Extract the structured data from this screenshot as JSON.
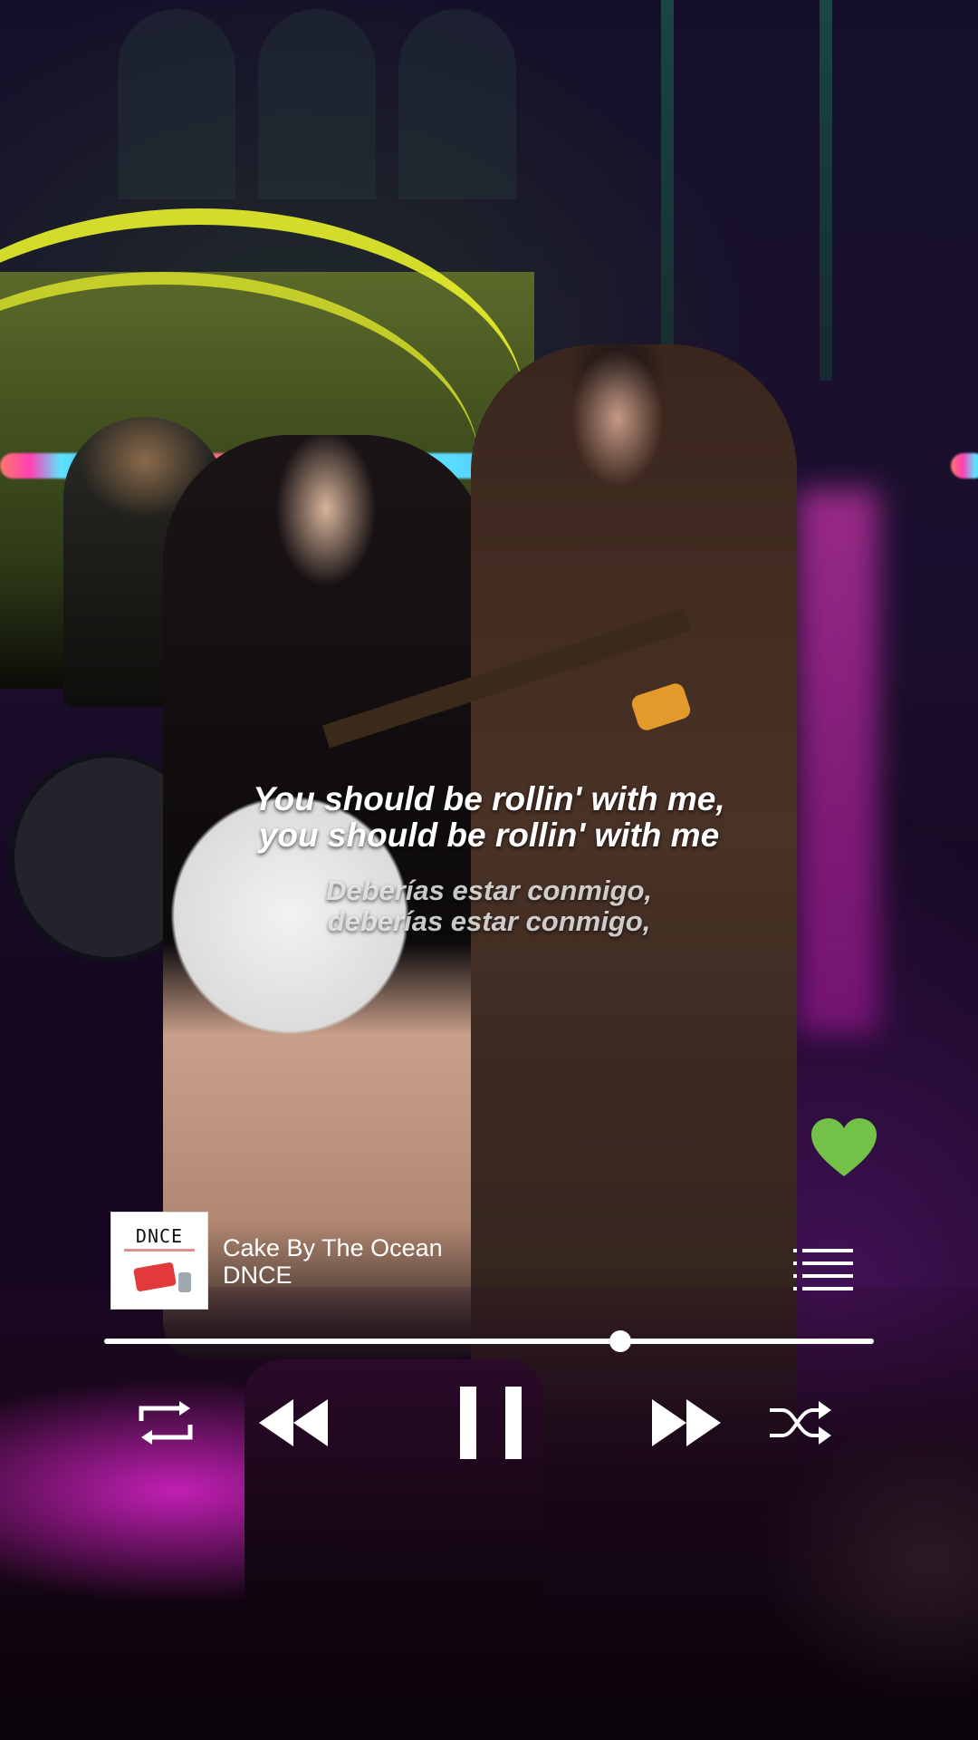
{
  "lyrics": {
    "original_line1": "You should be rollin' with me,",
    "original_line2": "you should be rollin' with me",
    "translation_line1": "Deberías estar conmigo,",
    "translation_line2": "deberías estar conmigo,"
  },
  "now_playing": {
    "title": "Cake By The Ocean",
    "artist": "DNCE",
    "album_art_text": "DNCE",
    "progress": 0.67
  },
  "favorite": {
    "liked": true,
    "color": "#73c148"
  },
  "controls": [
    "repeat-icon",
    "previous-icon",
    "pause-icon",
    "next-icon",
    "shuffle-icon"
  ],
  "colors": {
    "accent": "#73c148",
    "text": "#ffffff"
  }
}
